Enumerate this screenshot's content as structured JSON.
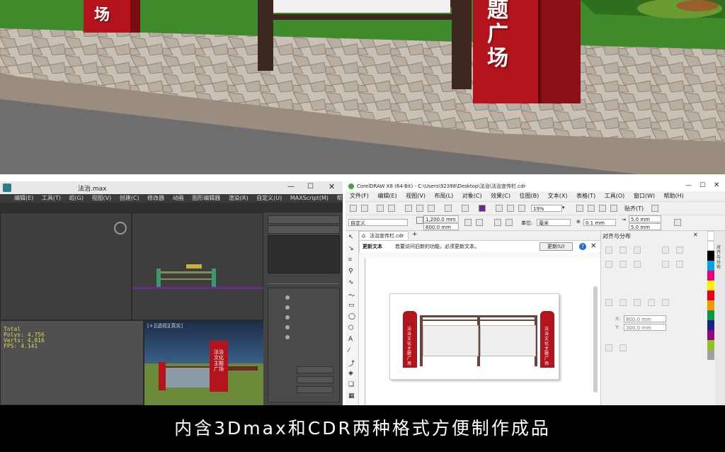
{
  "scene": {
    "left_sign_chars": "场",
    "right_sign_chars": [
      "题",
      "广",
      "场"
    ]
  },
  "max": {
    "title": "法治.max",
    "menu": [
      "编辑(E)",
      "工具(T)",
      "组(G)",
      "视图(V)",
      "创建(C)",
      "修改器",
      "动画",
      "图形编辑器",
      "渲染(R)",
      "自定义(U)",
      "MAXScript(M)",
      "帮助(H)"
    ],
    "stats": [
      "Total",
      "Polys: 4,756",
      "Verts: 4,816",
      "FPS: 4.141"
    ],
    "viewport_label": "[+][透视][真实]",
    "sign_text": "法治文化主题广场"
  },
  "cdr": {
    "title": "CorelDRAW X8 (64-Bit) - C:\\Users\\92398\\Desktop\\法治\\法治宣传栏.cdr",
    "menu": [
      "文件(F)",
      "编辑(E)",
      "视图(V)",
      "布局(L)",
      "对象(C)",
      "效果(C)",
      "位图(B)",
      "文本(X)",
      "表格(T)",
      "工具(O)",
      "窗口(W)",
      "帮助(H)"
    ],
    "zoom": "19%",
    "snap_label": "贴齐(T)",
    "preset": "自定义",
    "width": "1,200.0 mm",
    "height": "600.0 mm",
    "unit_label": "单位:",
    "unit": "毫米",
    "nudge": "0.1 mm",
    "dup_x": "5.0 mm",
    "dup_y": "5.0 mm",
    "tab": "法治宣传栏.cdr",
    "notice_title": "更新文本",
    "notice_body": "若要访问旧新的功能，必须更新文本。",
    "update_button": "更新(U)",
    "docker_title": "对齐与分布",
    "docker_x": "800.0 mm",
    "docker_y": "300.0 mm",
    "sign_text": "法治文化主题广场"
  },
  "banner": {
    "text": "内含3Dmax和CDR两种格式方便制作成品"
  },
  "colors": {
    "sign_red": "#b3141c",
    "frame_brown": "#4a2a20",
    "grass": "#3f8a2a"
  }
}
